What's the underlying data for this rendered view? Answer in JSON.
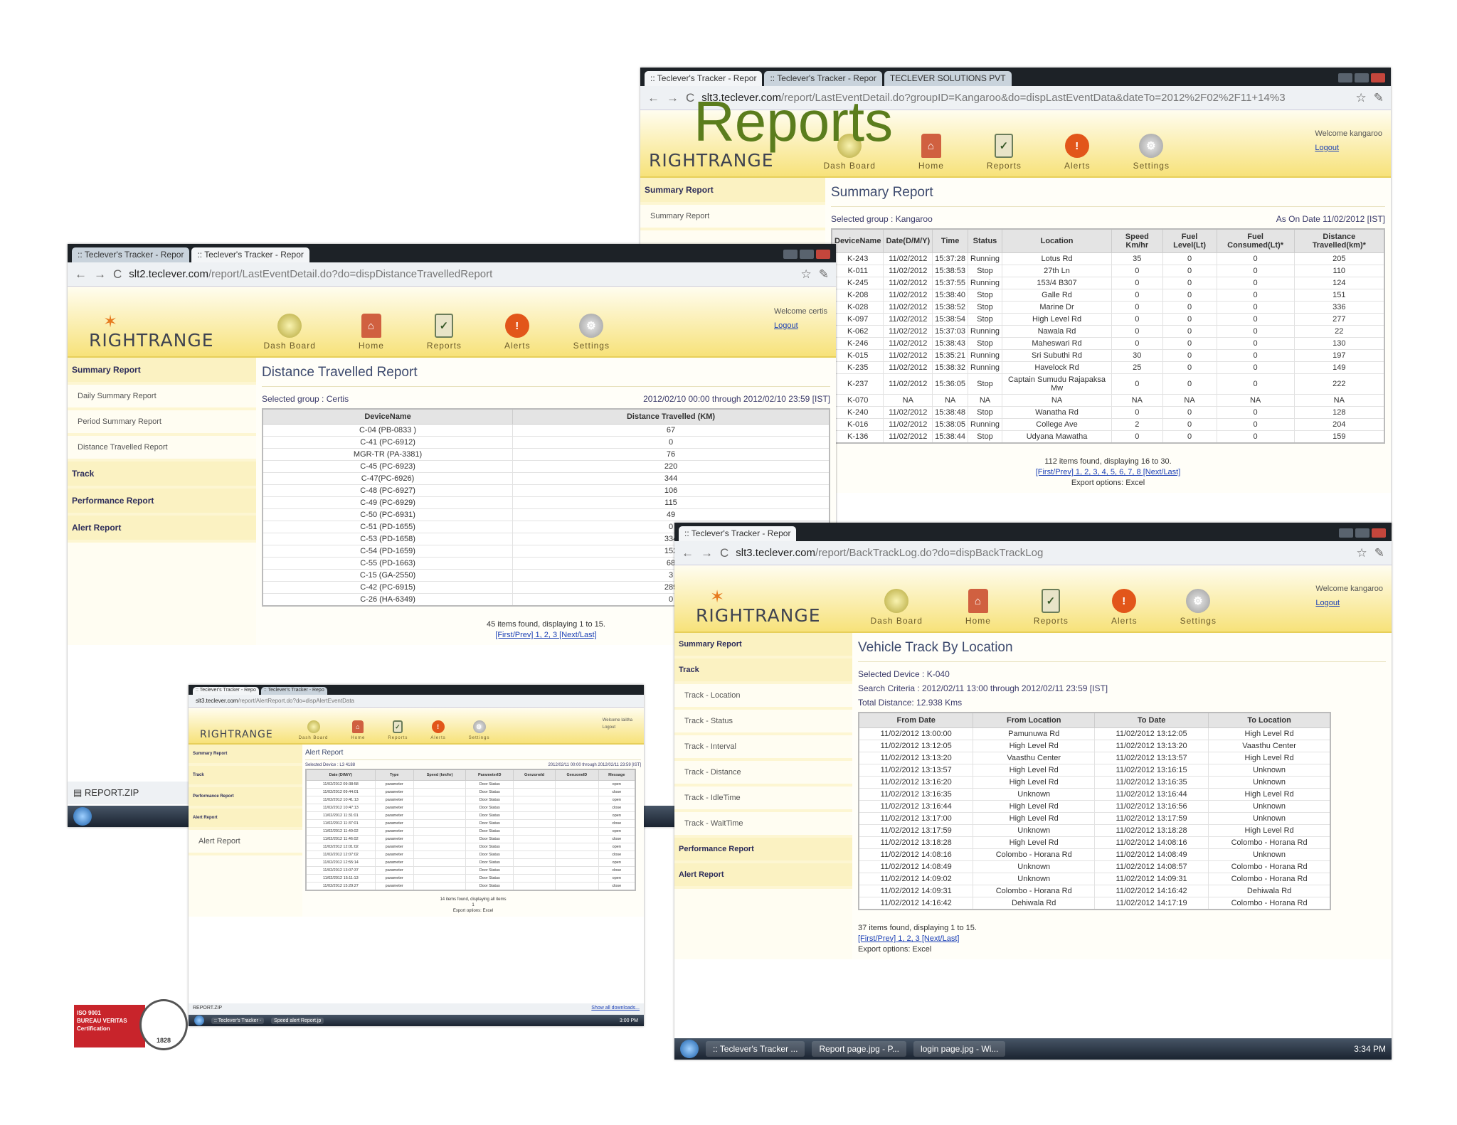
{
  "slide_title": "Reports",
  "brand": {
    "logo_text": "RIGHTRANGE",
    "accent": "#f7e27a",
    "nav_text": "#6b5b2a"
  },
  "nav": {
    "dash": "Dash Board",
    "home": "Home",
    "reports": "Reports",
    "alerts": "Alerts",
    "settings": "Settings"
  },
  "logout": "Logout",
  "cert": {
    "line1": "ISO 9001",
    "line2": "BUREAU VERITAS",
    "line3": "Certification",
    "year": "1828"
  },
  "s1": {
    "tabs": [
      ":: Teclever's Tracker - Repor",
      ":: Teclever's Tracker - Repor",
      "TECLEVER SOLUTIONS PVT"
    ],
    "url_host": "slt3.teclever.com",
    "url_path": "/report/LastEventDetail.do?groupID=Kangaroo&do=dispLastEventData&dateTo=2012%2F02%2F11+14%3",
    "welcome": "Welcome kangaroo",
    "side": [
      "Summary Report",
      "Summary Report"
    ],
    "title": "Summary Report",
    "group": "Selected group : Kangaroo",
    "asof": "As On Date 11/02/2012 [IST]",
    "headers": [
      "DeviceName",
      "Date(D/M/Y)",
      "Time",
      "Status",
      "Location",
      "Speed Km/hr",
      "Fuel Level(Lt)",
      "Fuel Consumed(Lt)*",
      "Distance Travelled(km)*"
    ],
    "rows": [
      [
        "K-243",
        "11/02/2012",
        "15:37:28",
        "Running",
        "Lotus Rd",
        "35",
        "0",
        "0",
        "205"
      ],
      [
        "K-011",
        "11/02/2012",
        "15:38:53",
        "Stop",
        "27th Ln",
        "0",
        "0",
        "0",
        "110"
      ],
      [
        "K-245",
        "11/02/2012",
        "15:37:55",
        "Running",
        "153/4 B307",
        "0",
        "0",
        "0",
        "124"
      ],
      [
        "K-208",
        "11/02/2012",
        "15:38:40",
        "Stop",
        "Galle Rd",
        "0",
        "0",
        "0",
        "151"
      ],
      [
        "K-028",
        "11/02/2012",
        "15:38:52",
        "Stop",
        "Marine Dr",
        "0",
        "0",
        "0",
        "336"
      ],
      [
        "K-097",
        "11/02/2012",
        "15:38:54",
        "Stop",
        "High Level Rd",
        "0",
        "0",
        "0",
        "277"
      ],
      [
        "K-062",
        "11/02/2012",
        "15:37:03",
        "Running",
        "Nawala Rd",
        "0",
        "0",
        "0",
        "22"
      ],
      [
        "K-246",
        "11/02/2012",
        "15:38:43",
        "Stop",
        "Maheswari Rd",
        "0",
        "0",
        "0",
        "130"
      ],
      [
        "K-015",
        "11/02/2012",
        "15:35:21",
        "Running",
        "Sri Subuthi Rd",
        "30",
        "0",
        "0",
        "197"
      ],
      [
        "K-235",
        "11/02/2012",
        "15:38:32",
        "Running",
        "Havelock Rd",
        "25",
        "0",
        "0",
        "149"
      ],
      [
        "K-237",
        "11/02/2012",
        "15:36:05",
        "Stop",
        "Captain Sumudu Rajapaksa Mw",
        "0",
        "0",
        "0",
        "222"
      ],
      [
        "K-070",
        "NA",
        "NA",
        "NA",
        "NA",
        "NA",
        "NA",
        "NA",
        "NA"
      ],
      [
        "K-240",
        "11/02/2012",
        "15:38:48",
        "Stop",
        "Wanatha Rd",
        "0",
        "0",
        "0",
        "128"
      ],
      [
        "K-016",
        "11/02/2012",
        "15:38:05",
        "Running",
        "College Ave",
        "2",
        "0",
        "0",
        "204"
      ],
      [
        "K-136",
        "11/02/2012",
        "15:38:44",
        "Stop",
        "Udyana Mawatha",
        "0",
        "0",
        "0",
        "159"
      ]
    ],
    "found": "112 items found, displaying 16 to 30.",
    "pager": "[First/Prev] 1, 2, 3, 4, 5, 6, 7, 8 [Next/Last]",
    "export": "Export options: Excel"
  },
  "s2": {
    "tabs": [
      ":: Teclever's Tracker - Repor",
      ":: Teclever's Tracker - Repor"
    ],
    "url_host": "slt2.teclever.com",
    "url_path": "/report/LastEventDetail.do?do=dispDistanceTravelledReport",
    "welcome": "Welcome certis",
    "side": [
      "Summary Report",
      "Daily Summary Report",
      "Period Summary Report",
      "Distance Travelled Report",
      "Track",
      "Performance Report",
      "Alert Report"
    ],
    "title": "Distance Travelled Report",
    "group": "Selected group : Certis",
    "range": "2012/02/10 00:00 through 2012/02/10 23:59 [IST]",
    "headers": [
      "DeviceName",
      "Distance Travelled (KM)"
    ],
    "rows": [
      [
        "C-04 (PB-0833 )",
        "67"
      ],
      [
        "C-41 (PC-6912)",
        "0"
      ],
      [
        "MGR-TR (PA-3381)",
        "76"
      ],
      [
        "C-45 (PC-6923)",
        "220"
      ],
      [
        "C-47(PC-6926)",
        "344"
      ],
      [
        "C-48 (PC-6927)",
        "106"
      ],
      [
        "C-49 (PC-6929)",
        "115"
      ],
      [
        "C-50 (PC-6931)",
        "49"
      ],
      [
        "C-51 (PD-1655)",
        "0"
      ],
      [
        "C-53 (PD-1658)",
        "334"
      ],
      [
        "C-54 (PD-1659)",
        "152"
      ],
      [
        "C-55 (PD-1663)",
        "68"
      ],
      [
        "C-15 (GA-2550)",
        "3"
      ],
      [
        "C-42 (PC-6915)",
        "289"
      ],
      [
        "C-26 (HA-6349)",
        "0"
      ]
    ],
    "found": "45 items found, displaying 1 to 15.",
    "pager": "[First/Prev] 1, 2, 3 [Next/Last]",
    "download": "REPORT.ZIP"
  },
  "s3": {
    "tabs": [
      ":: Teclever's Tracker - Repor"
    ],
    "url_host": "slt3.teclever.com",
    "url_path": "/report/BackTrackLog.do?do=dispBackTrackLog",
    "welcome": "Welcome kangaroo",
    "side": [
      "Summary Report",
      "Track",
      "Track - Location",
      "Track - Status",
      "Track - Interval",
      "Track - Distance",
      "Track - IdleTime",
      "Track - WaitTime",
      "Performance Report",
      "Alert Report"
    ],
    "title": "Vehicle Track By Location",
    "device": "Selected Device : K-040",
    "criteria": "Search Criteria : 2012/02/11 13:00 through 2012/02/11 23:59 [IST]",
    "distance": "Total Distance: 12.938 Kms",
    "headers": [
      "From Date",
      "From Location",
      "To Date",
      "To Location"
    ],
    "rows": [
      [
        "11/02/2012 13:00:00",
        "Pamunuwa Rd",
        "11/02/2012 13:12:05",
        "High Level Rd"
      ],
      [
        "11/02/2012 13:12:05",
        "High Level Rd",
        "11/02/2012 13:13:20",
        "Vaasthu Center"
      ],
      [
        "11/02/2012 13:13:20",
        "Vaasthu Center",
        "11/02/2012 13:13:57",
        "High Level Rd"
      ],
      [
        "11/02/2012 13:13:57",
        "High Level Rd",
        "11/02/2012 13:16:15",
        "Unknown"
      ],
      [
        "11/02/2012 13:16:20",
        "High Level Rd",
        "11/02/2012 13:16:35",
        "Unknown"
      ],
      [
        "11/02/2012 13:16:35",
        "Unknown",
        "11/02/2012 13:16:44",
        "High Level Rd"
      ],
      [
        "11/02/2012 13:16:44",
        "High Level Rd",
        "11/02/2012 13:16:56",
        "Unknown"
      ],
      [
        "11/02/2012 13:17:00",
        "High Level Rd",
        "11/02/2012 13:17:59",
        "Unknown"
      ],
      [
        "11/02/2012 13:17:59",
        "Unknown",
        "11/02/2012 13:18:28",
        "High Level Rd"
      ],
      [
        "11/02/2012 13:18:28",
        "High Level Rd",
        "11/02/2012 14:08:16",
        "Colombo - Horana Rd"
      ],
      [
        "11/02/2012 14:08:16",
        "Colombo - Horana Rd",
        "11/02/2012 14:08:49",
        "Unknown"
      ],
      [
        "11/02/2012 14:08:49",
        "Unknown",
        "11/02/2012 14:08:57",
        "Colombo - Horana Rd"
      ],
      [
        "11/02/2012 14:09:02",
        "Unknown",
        "11/02/2012 14:09:31",
        "Colombo - Horana Rd"
      ],
      [
        "11/02/2012 14:09:31",
        "Colombo - Horana Rd",
        "11/02/2012 14:16:42",
        "Dehiwala Rd"
      ],
      [
        "11/02/2012 14:16:42",
        "Dehiwala Rd",
        "11/02/2012 14:17:19",
        "Colombo - Horana Rd"
      ]
    ],
    "found": "37 items found, displaying 1 to 15.",
    "pager": "[First/Prev] 1, 2, 3 [Next/Last]",
    "export": "Export options: Excel",
    "taskbar": [
      ":: Teclever's Tracker ...",
      "Report page.jpg - P...",
      "login page.jpg - Wi..."
    ],
    "clock": "3:34 PM"
  },
  "s4": {
    "tabs": [
      ":: Teclever's Tracker - Repo",
      ":: Teclever's Tracker - Repo"
    ],
    "url_host": "slt3.teclever.com",
    "url_path": "/report/AlertReport.do?do=dispAlertEventData",
    "welcome": "Welcome lalitha",
    "side": [
      "Summary Report",
      "Track",
      "Performance Report",
      "Alert Report",
      "Alert Report"
    ],
    "title": "Alert Report",
    "device": "Selected Device : L3 4188",
    "range": "2012/02/11 00:00 through 2012/02/11 23:59 [IST]",
    "headers": [
      "Date (D/M/Y)",
      "Type",
      "Speed (km/hr)",
      "ParameterID",
      "GenzoneId",
      "GenzoneID",
      "Message"
    ],
    "rows": [
      [
        "11/02/2012 09:38:58",
        "parameter",
        "",
        "Door Status",
        "",
        "",
        "open"
      ],
      [
        "11/02/2012 09:44:01",
        "parameter",
        "",
        "Door Status",
        "",
        "",
        "close"
      ],
      [
        "11/02/2012 10:41:13",
        "parameter",
        "",
        "Door Status",
        "",
        "",
        "open"
      ],
      [
        "11/02/2012 10:47:13",
        "parameter",
        "",
        "Door Status",
        "",
        "",
        "close"
      ],
      [
        "11/02/2012 11:31:01",
        "parameter",
        "",
        "Door Status",
        "",
        "",
        "open"
      ],
      [
        "11/02/2012 11:37:01",
        "parameter",
        "",
        "Door Status",
        "",
        "",
        "close"
      ],
      [
        "11/02/2012 11:40:02",
        "parameter",
        "",
        "Door Status",
        "",
        "",
        "open"
      ],
      [
        "11/02/2012 11:46:02",
        "parameter",
        "",
        "Door Status",
        "",
        "",
        "close"
      ],
      [
        "11/02/2012 12:01:02",
        "parameter",
        "",
        "Door Status",
        "",
        "",
        "open"
      ],
      [
        "11/02/2012 12:07:02",
        "parameter",
        "",
        "Door Status",
        "",
        "",
        "close"
      ],
      [
        "11/02/2012 12:55:14",
        "parameter",
        "",
        "Door Status",
        "",
        "",
        "open"
      ],
      [
        "11/02/2012 13:07:37",
        "parameter",
        "",
        "Door Status",
        "",
        "",
        "close"
      ],
      [
        "11/02/2012 15:11:13",
        "parameter",
        "",
        "Door Status",
        "",
        "",
        "open"
      ],
      [
        "11/02/2012 15:29:27",
        "parameter",
        "",
        "Door Status",
        "",
        "",
        "close"
      ]
    ],
    "found": "14 items found, displaying all items",
    "pager": "1",
    "export": "Export options: Excel",
    "download": "REPORT.ZIP",
    "download_all": "Show all downloads...",
    "taskbar": [
      ":: Teclever's Tracker -",
      "Speed alert Report.jp"
    ],
    "clock": "3:00 PM"
  }
}
